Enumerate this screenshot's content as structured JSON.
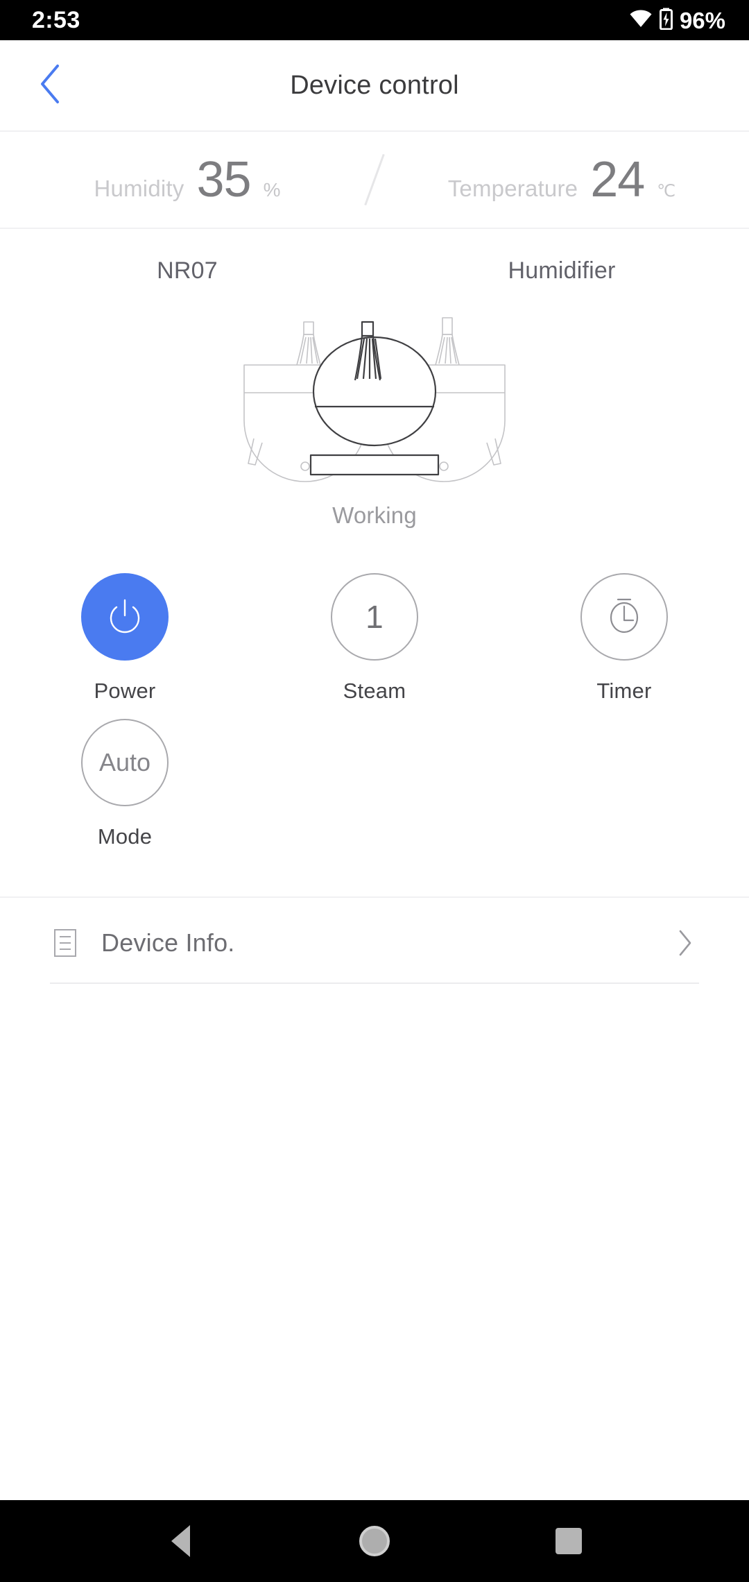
{
  "status_bar": {
    "time": "2:53",
    "battery_percent": "96%",
    "wifi_icon": "wifi-icon",
    "battery_icon": "battery-charging-icon"
  },
  "app_bar": {
    "back_icon": "chevron-left-icon",
    "title": "Device control",
    "accent_color": "#4a7bf0"
  },
  "sensors": [
    {
      "label": "Humidity",
      "value": "35",
      "unit": "%",
      "name": "humidity"
    },
    {
      "label": "Temperature",
      "value": "24",
      "unit": "℃",
      "name": "temperature"
    }
  ],
  "device": {
    "model": "NR07",
    "type": "Humidifier",
    "status": "Working",
    "illustration_icon": "humidifier-diffuser-illustration"
  },
  "controls": [
    {
      "label": "Power",
      "icon": "power-icon",
      "text": "",
      "active": true,
      "name": "power"
    },
    {
      "label": "Steam",
      "icon": "",
      "text": "1",
      "active": false,
      "name": "steam"
    },
    {
      "label": "Timer",
      "icon": "timer-icon",
      "text": "",
      "active": false,
      "name": "timer"
    },
    {
      "label": "Mode",
      "icon": "",
      "text": "Auto",
      "active": false,
      "name": "mode"
    }
  ],
  "info": {
    "icon": "document-list-icon",
    "label": "Device Info.",
    "chevron_icon": "chevron-right-icon"
  },
  "nav_bar": {
    "back": "back-triangle-icon",
    "home": "home-circle-icon",
    "recents": "recents-square-icon"
  },
  "colors": {
    "accent": "#4a7bf0",
    "text_primary": "#3b3b3d",
    "text_secondary": "#9a9a9e",
    "text_muted": "#c9c9cc"
  }
}
